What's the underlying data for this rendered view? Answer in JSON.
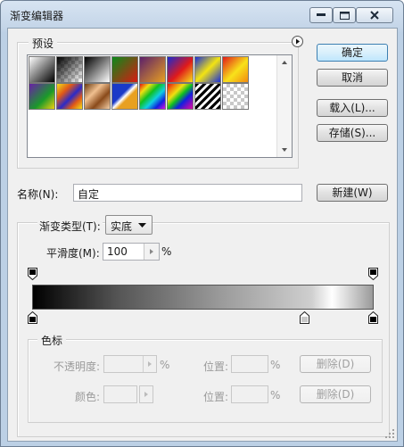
{
  "window": {
    "title": "渐变编辑器"
  },
  "presets": {
    "legend": "预设"
  },
  "buttons": {
    "ok": "确定",
    "cancel": "取消",
    "load": "载入(L)...",
    "save": "存储(S)...",
    "new": "新建(W)"
  },
  "name_field": {
    "label": "名称(N):",
    "value": "自定"
  },
  "gradient_type": {
    "label": "渐变类型(T):",
    "value": "实底"
  },
  "smoothness": {
    "label": "平滑度(M):",
    "value": "100",
    "unit": "%"
  },
  "color_stops": {
    "legend": "色标",
    "opacity_label": "不透明度:",
    "opacity_unit": "%",
    "location_label": "位置:",
    "location_unit": "%",
    "delete_label": "删除(D)",
    "color_label": "颜色:"
  },
  "colors": {
    "accent": "#3c7fb1",
    "gradient_start": "#000000",
    "gradient_end": "#ffffff"
  },
  "icons": [
    "minimize-icon",
    "maximize-icon",
    "close-icon",
    "flyout-arrow-icon",
    "dropdown-arrow-icon",
    "stepper-arrow-icon",
    "color-picker-arrow-icon"
  ]
}
